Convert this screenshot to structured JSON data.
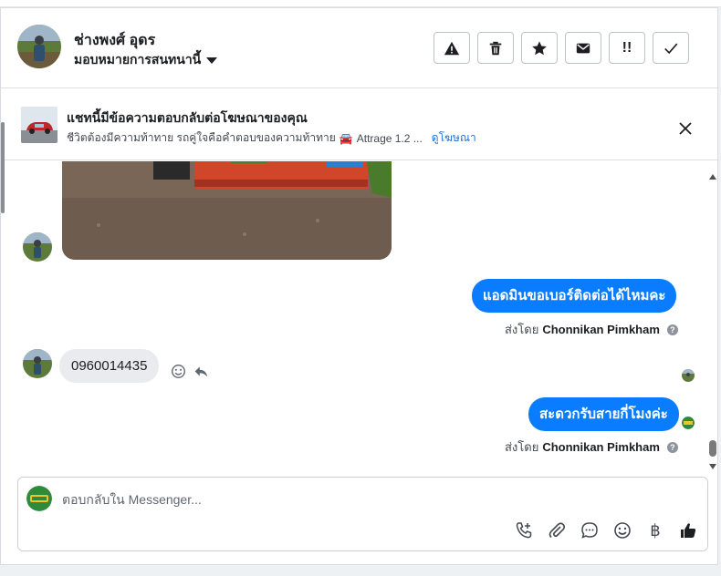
{
  "header": {
    "contact_name": "ช่างพงศ์ อุดร",
    "assign_label": "มอบหมายการสนทนานี้",
    "actions": [
      {
        "name": "spam-button",
        "icon": "warning-icon"
      },
      {
        "name": "delete-button",
        "icon": "trash-icon"
      },
      {
        "name": "star-button",
        "icon": "star-icon"
      },
      {
        "name": "mark-unread-button",
        "icon": "envelope-icon"
      },
      {
        "name": "follow-up-button",
        "icon": "follow-up-icon",
        "text": "!!"
      },
      {
        "name": "done-button",
        "icon": "check-icon"
      }
    ]
  },
  "ad_banner": {
    "title": "แชทนี้มีข้อความตอบกลับต่อโฆษณาของคุณ",
    "subtitle": "ชีวิตต้องมีความท้าทาย รถคู่ใจคือคำตอบของความท้าทาย",
    "car_emoji": "🚘",
    "car_text": "Attrage 1.2 ...",
    "link": "ดูโฆษณา"
  },
  "messages": {
    "out1": "แอดมินขอเบอร์ติดต่อได้ไหมคะ",
    "sent_by_prefix": "ส่งโดย",
    "sent_by_name": "Chonnikan Pimkham",
    "in1": "0960014435",
    "out2": "สะดวกรับสายกี่โมงค่ะ"
  },
  "composer": {
    "placeholder": "ตอบกลับใน Messenger...",
    "baht_symbol": "฿"
  },
  "colors": {
    "accent": "#0a7cff",
    "link": "#216fdb",
    "incoming_bubble": "#e9ebee"
  }
}
